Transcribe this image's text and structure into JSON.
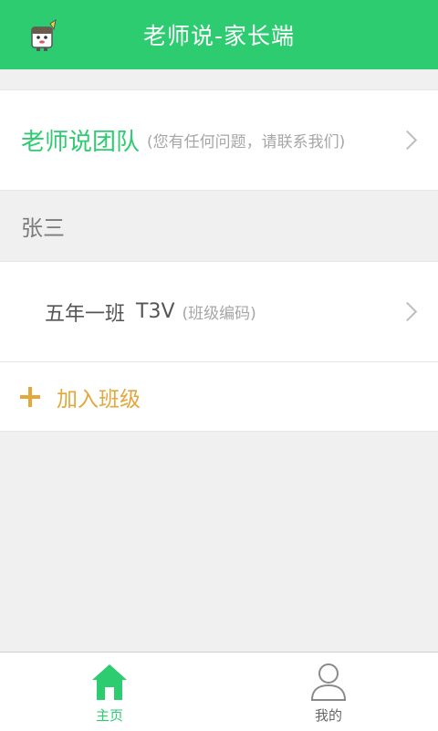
{
  "header": {
    "title": "老师说-家长端",
    "logo_icon": "mascot-logo-icon"
  },
  "team": {
    "name": "老师说团队",
    "hint": "(您有任何问题，请联系我们)",
    "chevron_icon": "chevron-right-icon"
  },
  "student": {
    "name": "张三"
  },
  "classes": [
    {
      "name": "五年一班",
      "code": "T3V",
      "code_hint": "(班级编码)",
      "chevron_icon": "chevron-right-icon"
    }
  ],
  "join": {
    "label": "加入班级",
    "icon": "plus-icon"
  },
  "tabs": [
    {
      "label": "主页",
      "icon": "home-icon",
      "active": true
    },
    {
      "label": "我的",
      "icon": "user-icon",
      "active": false
    }
  ],
  "colors": {
    "primary": "#2ecc71",
    "accent": "#e3a73b",
    "background": "#f0f0f0",
    "hint_text": "#a6a6a6"
  }
}
